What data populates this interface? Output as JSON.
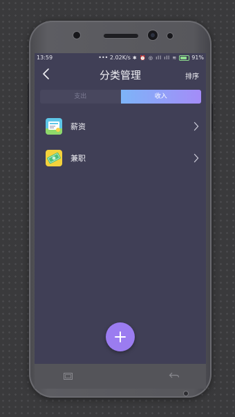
{
  "status": {
    "time": "13:59",
    "network_speed": "••• 2.02K/s",
    "icons": "✱ ⏰ ◎ ıll ıll ≋",
    "battery": "91%"
  },
  "header": {
    "title": "分类管理",
    "sort_label": "排序",
    "back_icon": "chevron-left-icon"
  },
  "tabs": [
    {
      "label": "支出",
      "active": false
    },
    {
      "label": "收入",
      "active": true
    }
  ],
  "categories": [
    {
      "label": "薪资",
      "icon": "salary-icon"
    },
    {
      "label": "兼职",
      "icon": "part-time-icon"
    }
  ],
  "fab": {
    "icon": "plus-icon"
  },
  "colors": {
    "screen_bg": "#403f56",
    "tab_active_gradient_start": "#7db4f8",
    "tab_active_gradient_end": "#a48cf8",
    "fab": "#9b7cf0"
  }
}
